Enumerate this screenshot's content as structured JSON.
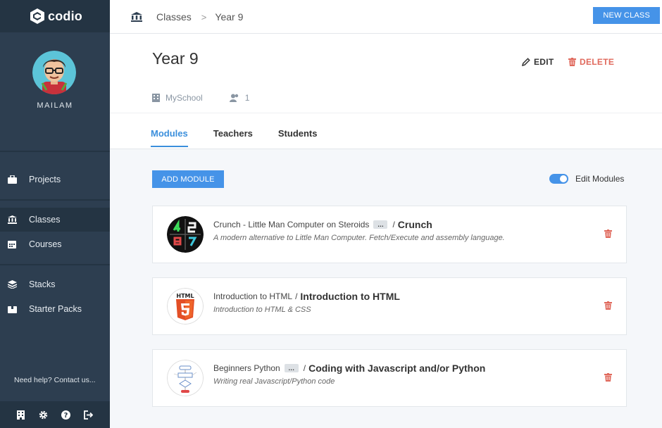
{
  "app": {
    "logo_text": "codio"
  },
  "user": {
    "name": "MAILAM"
  },
  "sidebar": {
    "items": [
      {
        "label": "Projects",
        "icon": "briefcase-icon"
      },
      {
        "label": "Classes",
        "icon": "bank-icon"
      },
      {
        "label": "Courses",
        "icon": "calendar-icon"
      },
      {
        "label": "Stacks",
        "icon": "layers-icon"
      },
      {
        "label": "Starter Packs",
        "icon": "box-icon"
      }
    ],
    "help": "Need help? Contact us..."
  },
  "breadcrumb": {
    "root": "Classes",
    "current": "Year 9"
  },
  "toolbar": {
    "new_class": "NEW CLASS"
  },
  "class": {
    "title": "Year 9",
    "edit": "EDIT",
    "delete": "DELETE",
    "school": "MySchool",
    "member_count": "1"
  },
  "tabs": [
    {
      "label": "Modules",
      "active": true
    },
    {
      "label": "Teachers",
      "active": false
    },
    {
      "label": "Students",
      "active": false
    }
  ],
  "modules_actions": {
    "add_module": "ADD MODULE",
    "edit_modules": "Edit Modules",
    "edit_modules_on": true
  },
  "modules": [
    {
      "name": "Crunch - Little Man Computer on Steroids",
      "has_more": true,
      "course": "Crunch",
      "description": "A modern alternative to Little Man Computer. Fetch/Execute and assembly language."
    },
    {
      "name": "Introduction to HTML",
      "has_more": false,
      "course": "Introduction to HTML",
      "description": "Introduction to HTML & CSS"
    },
    {
      "name": "Beginners Python",
      "has_more": true,
      "course": "Coding with Javascript and/or Python",
      "description": "Writing real Javascript/Python code"
    }
  ],
  "more_label": "…",
  "colors": {
    "accent": "#4593e8",
    "sidebar": "#2d3e50",
    "danger": "#e0695c"
  }
}
